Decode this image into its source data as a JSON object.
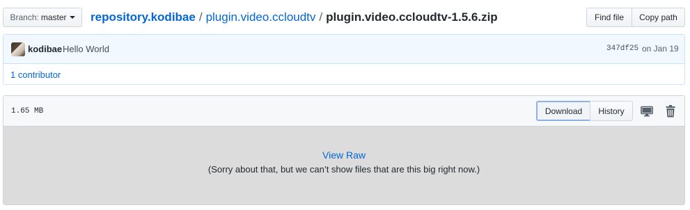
{
  "branch": {
    "prefix": "Branch:",
    "name": "master"
  },
  "breadcrumb": {
    "repo": "repository.kodibae",
    "separator": "/",
    "folder": "plugin.video.ccloudtv",
    "file": "plugin.video.ccloudtv-1.5.6.zip"
  },
  "actions": {
    "find_file": "Find file",
    "copy_path": "Copy path"
  },
  "commit": {
    "author": "kodibae",
    "message": "Hello World",
    "sha": "347df25",
    "date": "on Jan 19",
    "contributors": "1 contributor"
  },
  "file": {
    "size": "1.65 MB",
    "download_label": "Download",
    "history_label": "History",
    "view_raw": "View Raw",
    "notice": "(Sorry about that, but we can’t show files that are this big right now.)"
  },
  "icons": {
    "desktop": "monitor-icon",
    "delete": "trash-icon"
  },
  "colors": {
    "link": "#0366d6",
    "commit_bg": "#f1f8ff",
    "file_body_bg": "#dcdcdc"
  }
}
